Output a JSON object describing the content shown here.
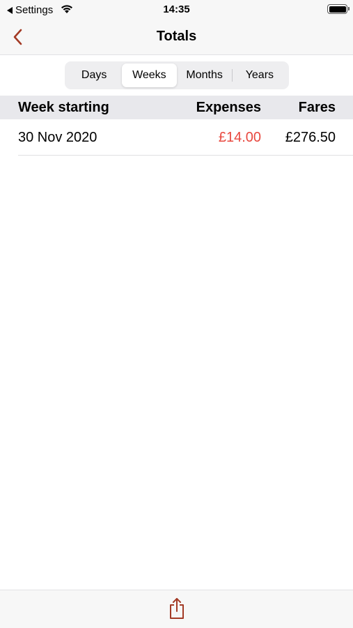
{
  "status_bar": {
    "back_app": "Settings",
    "time": "14:35"
  },
  "nav": {
    "title": "Totals",
    "back_icon": "chevron-left-icon"
  },
  "segments": {
    "items": [
      {
        "label": "Days"
      },
      {
        "label": "Weeks"
      },
      {
        "label": "Months"
      },
      {
        "label": "Years"
      }
    ],
    "selected": "Weeks"
  },
  "table": {
    "columns": {
      "date": "Week starting",
      "expenses": "Expenses",
      "fares": "Fares"
    },
    "rows": [
      {
        "date": "30 Nov 2020",
        "expenses": "£14.00",
        "fares": "£276.50"
      }
    ]
  },
  "toolbar": {
    "share_icon": "share-icon"
  },
  "colors": {
    "accent": "#a33a25",
    "expense_red": "#e8483f",
    "bar_background": "#f7f7f7",
    "header_background": "#e8e8ec"
  }
}
